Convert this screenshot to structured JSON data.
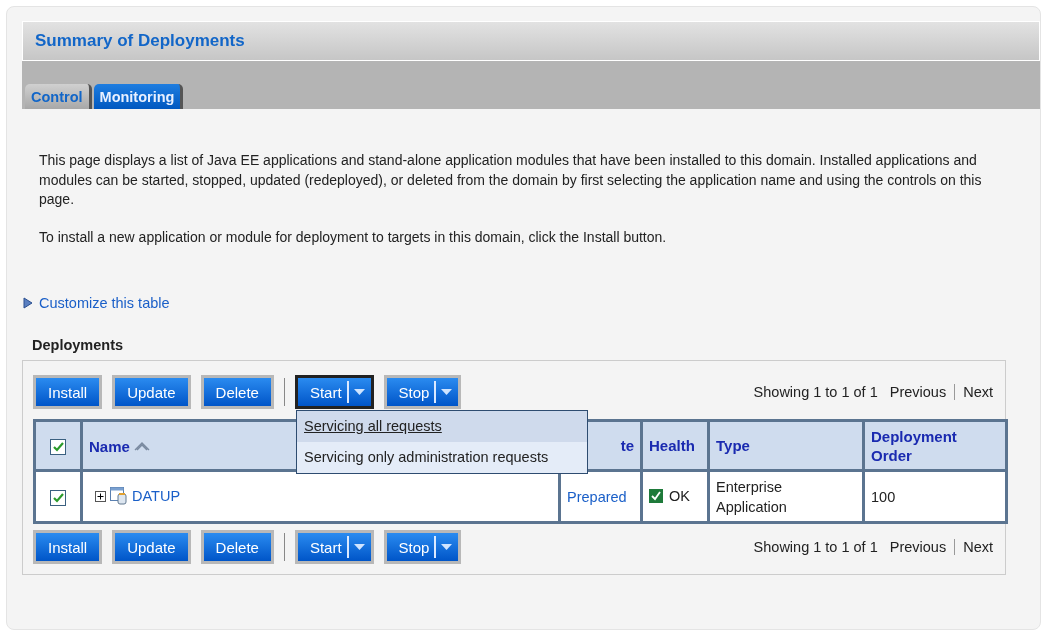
{
  "title": "Summary of Deployments",
  "tabs": [
    {
      "label": "Control",
      "selected": false
    },
    {
      "label": "Monitoring",
      "selected": true
    }
  ],
  "intro": [
    "This page displays a list of Java EE applications and stand-alone application modules that have been installed to this domain. Installed applications and modules can be started, stopped, updated (redeployed), or deleted from the domain by first selecting the application name and using the controls on this page.",
    "To install a new application or module for deployment to targets in this domain, click the Install button."
  ],
  "customize_link": "Customize this table",
  "table_title": "Deployments",
  "toolbars": [
    {
      "buttons": [
        {
          "label": "Install",
          "kind": "plain"
        },
        {
          "label": "Update",
          "kind": "plain"
        },
        {
          "label": "Delete",
          "kind": "plain"
        },
        {
          "label": "Start",
          "kind": "menu",
          "open": true
        },
        {
          "label": "Stop",
          "kind": "menu",
          "open": false
        }
      ],
      "paging": "Showing 1 to 1 of 1",
      "previous": "Previous",
      "next": "Next"
    },
    {
      "buttons": [
        {
          "label": "Install",
          "kind": "plain"
        },
        {
          "label": "Update",
          "kind": "plain"
        },
        {
          "label": "Delete",
          "kind": "plain"
        },
        {
          "label": "Start",
          "kind": "menu",
          "open": false
        },
        {
          "label": "Stop",
          "kind": "menu",
          "open": false
        }
      ],
      "paging": "Showing 1 to 1 of 1",
      "previous": "Previous",
      "next": "Next"
    }
  ],
  "menu": [
    {
      "label": "Servicing all requests",
      "selected": true
    },
    {
      "label": "Servicing only administration requests",
      "selected": false
    }
  ],
  "columns": {
    "select_all_checked": true,
    "name": "Name",
    "column_3": "te",
    "health": "Health",
    "type": "Type",
    "order": "Deployment Order"
  },
  "rows": [
    {
      "checked": true,
      "name": "DATUP",
      "state": "Prepared",
      "health": "OK",
      "type": "Enterprise Application",
      "order": "100"
    }
  ]
}
